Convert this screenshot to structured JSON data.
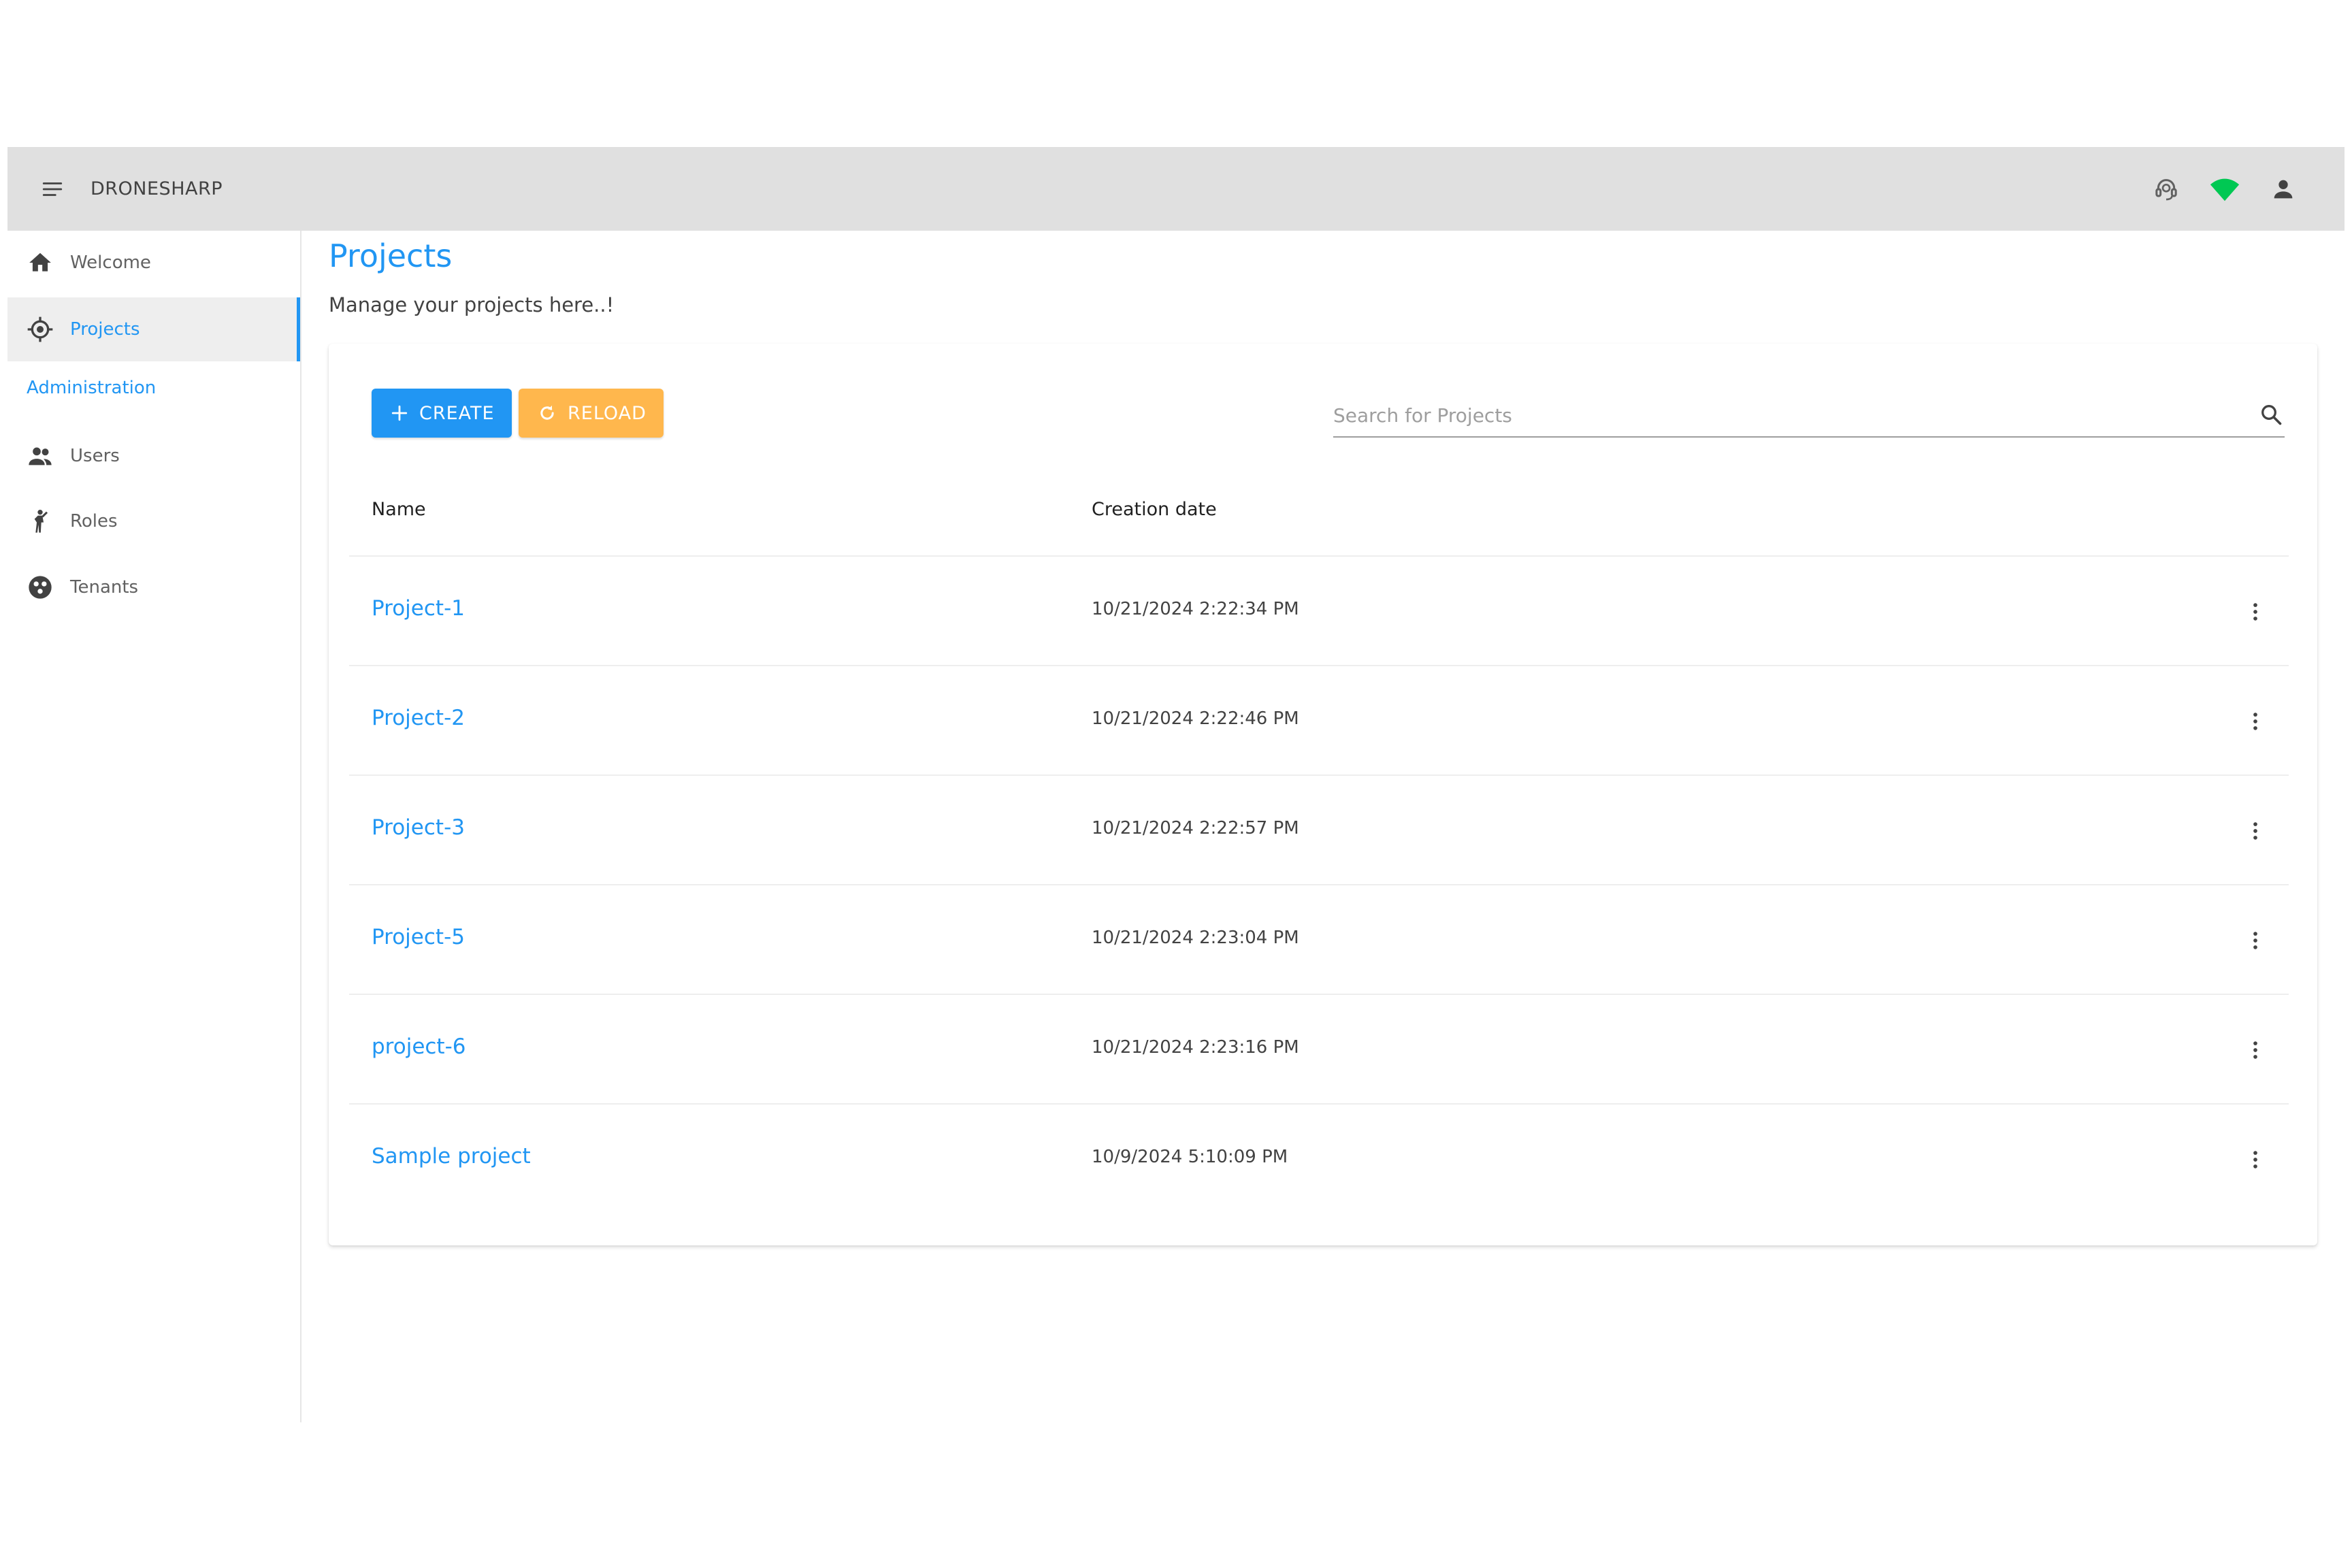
{
  "app": {
    "title": "DRONESHARP",
    "menu_icon": "hamburger-menu-icon",
    "actions": [
      {
        "icon": "support-agent-icon",
        "color": "#616161"
      },
      {
        "icon": "wifi-signal-icon",
        "color": "#00c853"
      },
      {
        "icon": "account-icon",
        "color": "#424242"
      }
    ]
  },
  "sidebar": {
    "items": [
      {
        "label": "Welcome",
        "icon": "home-icon",
        "active": false
      },
      {
        "label": "Projects",
        "icon": "gps-target-icon",
        "active": true
      }
    ],
    "section_label": "Administration",
    "admin_items": [
      {
        "label": "Users",
        "icon": "people-icon"
      },
      {
        "label": "Roles",
        "icon": "person-role-icon"
      },
      {
        "label": "Tenants",
        "icon": "tenants-icon"
      }
    ]
  },
  "page": {
    "title": "Projects",
    "subtitle": "Manage your projects here..!"
  },
  "toolbar": {
    "create_label": "CREATE",
    "reload_label": "RELOAD",
    "search_placeholder": "Search for Projects"
  },
  "table": {
    "columns": [
      "Name",
      "Creation date"
    ],
    "rows": [
      {
        "name": "Project-1",
        "created": "10/21/2024 2:22:34 PM"
      },
      {
        "name": "Project-2",
        "created": "10/21/2024 2:22:46 PM"
      },
      {
        "name": "Project-3",
        "created": "10/21/2024 2:22:57 PM"
      },
      {
        "name": "Project-5",
        "created": "10/21/2024 2:23:04 PM"
      },
      {
        "name": "project-6",
        "created": "10/21/2024 2:23:16 PM"
      },
      {
        "name": "Sample project",
        "created": "10/9/2024 5:10:09 PM"
      }
    ]
  },
  "colors": {
    "primary": "#2196f3",
    "warning": "#ffb74d",
    "appbar": "#e0e0e0",
    "online": "#00c853"
  }
}
